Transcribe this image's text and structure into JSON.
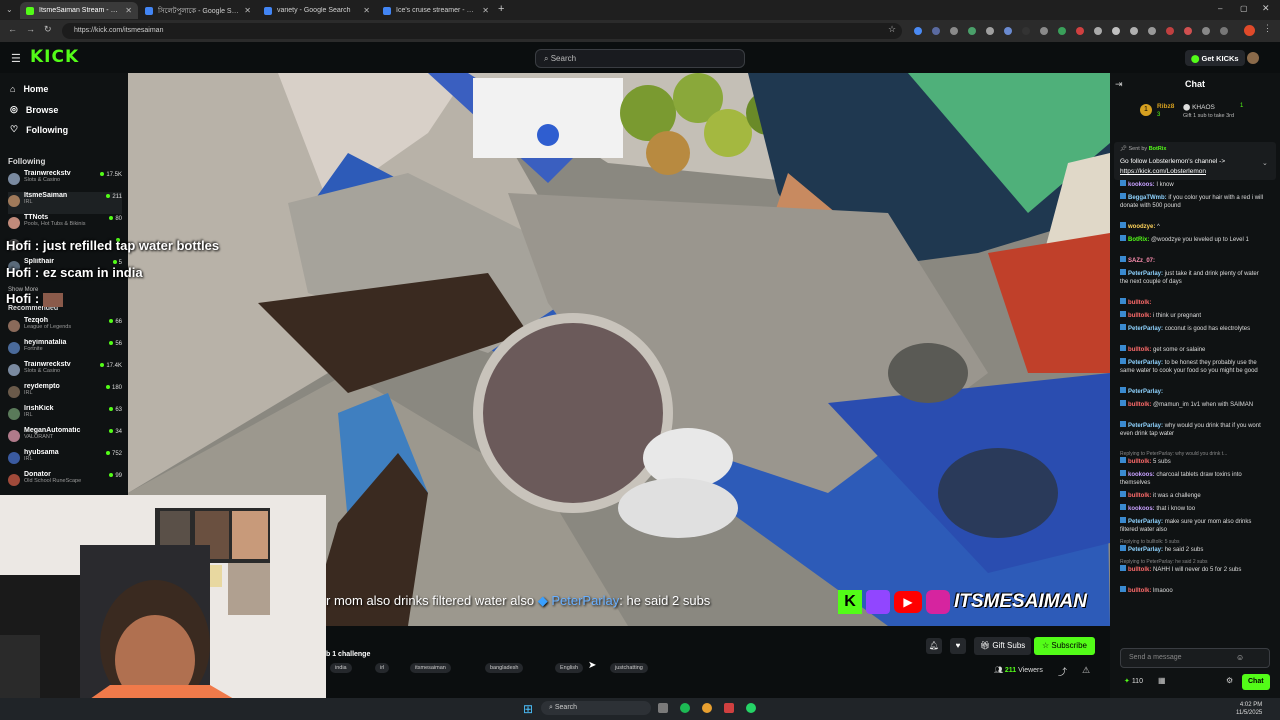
{
  "browser": {
    "tabs": [
      {
        "label": "ItsmeSaiman Stream - Wat",
        "color": "#53fc18",
        "active": true
      },
      {
        "label": "সিলেটপুলাকে - Google Search",
        "color": "#4285f4",
        "active": false
      },
      {
        "label": "variety - Google Search",
        "color": "#4285f4",
        "active": false
      },
      {
        "label": "Ice's cruise streamer - Google S",
        "color": "#4285f4",
        "active": false
      }
    ],
    "new_tab": "+",
    "url": "https://kick.com/itsmesaiman"
  },
  "header": {
    "logo": "KICK",
    "search_placeholder": "Search",
    "get_kicks": "Get KICKs"
  },
  "sidebar": {
    "nav": [
      {
        "label": "Home",
        "icon": "home-icon"
      },
      {
        "label": "Browse",
        "icon": "browse-icon"
      },
      {
        "label": "Following",
        "icon": "heart-icon"
      }
    ],
    "following_title": "Following",
    "following": [
      {
        "name": "Trainwreckstv",
        "cat": "Slots & Casino",
        "viewers": "17.5K",
        "color": "#7a8aa0"
      },
      {
        "name": "ItsmeSaiman",
        "cat": "IRL",
        "viewers": "211",
        "color": "#a07a5a",
        "selected": true
      },
      {
        "name": "TTNots",
        "cat": "Pools, Hot Tubs & Bikinis",
        "viewers": "80",
        "color": "#c08a7a"
      },
      {
        "name": "",
        "cat": "",
        "viewers": "",
        "color": "#555"
      },
      {
        "name": "Spliithair",
        "cat": "",
        "viewers": "5",
        "color": "#5a6a7a"
      }
    ],
    "show_more": "Show More",
    "recommended_title": "Recommended",
    "recommended": [
      {
        "name": "Tezqoh",
        "cat": "League of Legends",
        "viewers": "66",
        "color": "#8a6a5a"
      },
      {
        "name": "heyimnatalia",
        "cat": "Fortnite",
        "viewers": "56",
        "color": "#4a6a9a"
      },
      {
        "name": "Trainwreckstv",
        "cat": "Slots & Casino",
        "viewers": "17.4K",
        "color": "#7a8aa0"
      },
      {
        "name": "reydempto",
        "cat": "IRL",
        "viewers": "180",
        "color": "#6a5a4a"
      },
      {
        "name": "IrishKick",
        "cat": "IRL",
        "viewers": "63",
        "color": "#5a7a5a"
      },
      {
        "name": "MeganAutomatic",
        "cat": "VALORANT",
        "viewers": "34",
        "color": "#b07a8a"
      },
      {
        "name": "hyubsama",
        "cat": "IRL",
        "viewers": "752",
        "color": "#3a5aa0"
      },
      {
        "name": "Donator",
        "cat": "Old School RuneScape",
        "viewers": "99",
        "color": "#a04a3a"
      }
    ]
  },
  "overlay": {
    "line1_user": "Hofi :",
    "line1_text": "just refilled tap water bottles",
    "line2_user": "Hofi :",
    "line2_text": "ez scam in india",
    "line3_user": "Hofi :"
  },
  "video": {
    "caption": "r mom also drinks filtered water also",
    "caption_user": "PeterParlay",
    "caption_reply": ": he said 2 subs",
    "brand": "ITSMESAIMAN"
  },
  "stream": {
    "title": "b 1 challenge",
    "tags": [
      "india",
      "irl",
      "itsmesaiman",
      "bangladesh",
      "English",
      "justchatting"
    ],
    "gift_subs": "Gift Subs",
    "subscribe": "Subscribe",
    "viewers": "211",
    "viewers_label": "Viewers"
  },
  "chat": {
    "title": "Chat",
    "top_gifters": [
      {
        "name": "Ribz8",
        "count": "3"
      },
      {
        "name": "KHAOS",
        "count": "1"
      }
    ],
    "gift_hint": "Gift 1 sub to take 3rd",
    "pinned_by": "Sent by",
    "pinned_user": "BotRix",
    "pinned_text": "Go follow Lobsterlemon's channel ->",
    "pinned_link": "https://kick.com/Lobsterlemon",
    "messages": [
      {
        "user": "kookoos:",
        "text": "I know",
        "color": "#c8a0ff"
      },
      {
        "user": "BeggaTWmb:",
        "text": "if you color your hair with a red i will donate with 500 pound",
        "color": "#8fd3ff"
      },
      {
        "user": "woodzye:",
        "text": "^",
        "color": "#ffd35a"
      },
      {
        "user": "BotRix:",
        "text": "@woodzye you leveled up to Level 1",
        "color": "#53fc18"
      },
      {
        "user": "SAZz_07:",
        "text": "",
        "color": "#ff8fb1"
      },
      {
        "user": "PeterParlay:",
        "text": "just take it and drink plenty of water the next couple of days",
        "color": "#8fd3ff"
      },
      {
        "user": "bulltolk:",
        "text": "",
        "color": "#ff6b6b"
      },
      {
        "user": "bulltolk:",
        "text": "i think ur pregnant",
        "color": "#ff6b6b"
      },
      {
        "user": "PeterParlay:",
        "text": "coconut is good has electrolytes",
        "color": "#8fd3ff"
      },
      {
        "user": "bulltolk:",
        "text": "get some or salaine",
        "color": "#ff6b6b"
      },
      {
        "user": "PeterParlay:",
        "text": "to be honest they probably use the same water to cook your food so you might be good",
        "color": "#8fd3ff"
      },
      {
        "user": "PeterParlay:",
        "text": "",
        "color": "#8fd3ff"
      },
      {
        "user": "bulltolk:",
        "text": "@mamun_im 1v1 when with SAIMAN",
        "color": "#ff6b6b"
      },
      {
        "user": "PeterParlay:",
        "text": "why would you drink that if you wont even drink tap water",
        "color": "#8fd3ff"
      },
      {
        "user": "bulltolk:",
        "text": "5 subs",
        "color": "#ff6b6b",
        "reply": "Replying to PeterParlay: why would you drink t..."
      },
      {
        "user": "kookoos:",
        "text": "charcoal tablets draw toxins into themselves",
        "color": "#c8a0ff"
      },
      {
        "user": "bulltolk:",
        "text": "it was a challenge",
        "color": "#ff6b6b"
      },
      {
        "user": "kookoos:",
        "text": "that i know too",
        "color": "#c8a0ff"
      },
      {
        "user": "PeterParlay:",
        "text": "make sure your mom also drinks filtered water also",
        "color": "#8fd3ff"
      },
      {
        "user": "PeterParlay:",
        "text": "he said 2 subs",
        "color": "#8fd3ff",
        "reply": "Replying to bulltolk: 5 subs"
      },
      {
        "user": "bulltolk:",
        "text": "NAHH I will never do 5 for 2 subs",
        "color": "#ff6b6b",
        "reply": "Replying to PeterParlay: he said 2 subs"
      },
      {
        "user": "bulltolk:",
        "text": "lmaooo",
        "color": "#ff6b6b"
      }
    ],
    "input_placeholder": "Send a message",
    "points": "110",
    "send_label": "Chat"
  },
  "taskbar": {
    "search": "Search",
    "time": "4:02 PM",
    "date": "11/5/2025"
  }
}
